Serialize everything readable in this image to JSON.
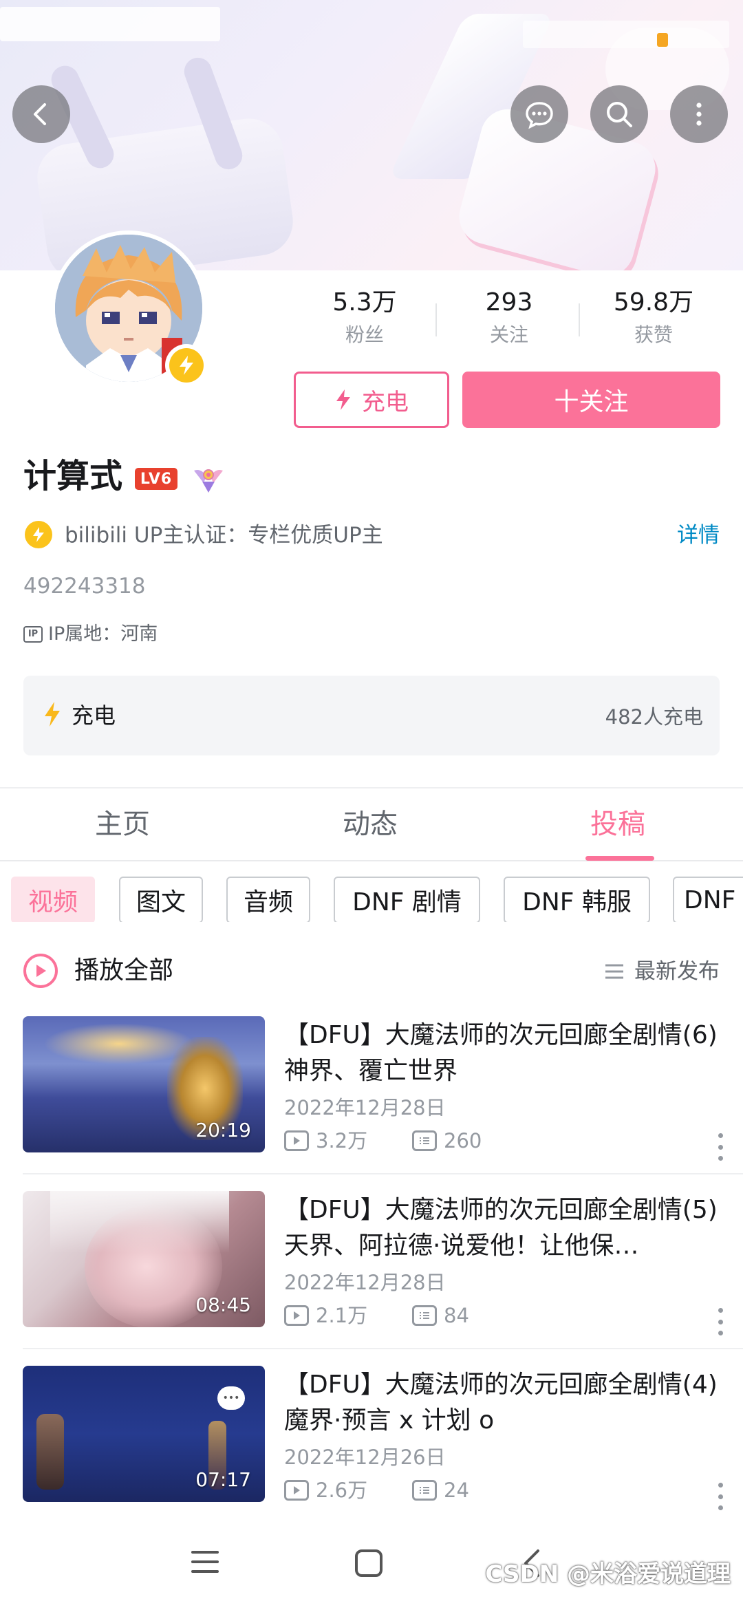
{
  "banner": {
    "accent": "#fb7299"
  },
  "profile": {
    "stats": [
      {
        "value": "5.3万",
        "label": "粉丝"
      },
      {
        "value": "293",
        "label": "关注"
      },
      {
        "value": "59.8万",
        "label": "获赞"
      }
    ],
    "charge_button": "充电",
    "follow_button": "十关注",
    "name": "计算式",
    "level": "LV6",
    "certification": "bilibili UP主认证：专栏优质UP主",
    "cert_detail_link": "详情",
    "uid": "492243318",
    "ip_badge": "IP",
    "ip_location": "IP属地：河南"
  },
  "charge_card": {
    "title": "充电",
    "count": "482人充电"
  },
  "tabs": [
    {
      "label": "主页",
      "active": false
    },
    {
      "label": "动态",
      "active": false
    },
    {
      "label": "投稿",
      "active": true
    }
  ],
  "chips": [
    {
      "label": "视频",
      "active": true
    },
    {
      "label": "图文",
      "active": false
    },
    {
      "label": "音频",
      "active": false
    },
    {
      "label": "DNF 剧情",
      "active": false
    },
    {
      "label": "DNF 韩服",
      "active": false
    },
    {
      "label": "DNF",
      "active": false
    }
  ],
  "playall": {
    "label": "播放全部",
    "sort": "最新发布"
  },
  "videos": [
    {
      "title": "【DFU】大魔法师的次元回廊全剧情(6)神界、覆亡世界",
      "date": "2022年12月28日",
      "views": "3.2万",
      "comments": "260",
      "duration": "20:19"
    },
    {
      "title": "【DFU】大魔法师的次元回廊全剧情(5)天界、阿拉德·说爱他！让他保…",
      "date": "2022年12月28日",
      "views": "2.1万",
      "comments": "84",
      "duration": "08:45"
    },
    {
      "title": "【DFU】大魔法师的次元回廊全剧情(4)魔界·预言 x 计划 o",
      "date": "2022年12月26日",
      "views": "2.6万",
      "comments": "24",
      "duration": "07:17"
    }
  ],
  "watermark": "CSDN @米浴爱说道理"
}
